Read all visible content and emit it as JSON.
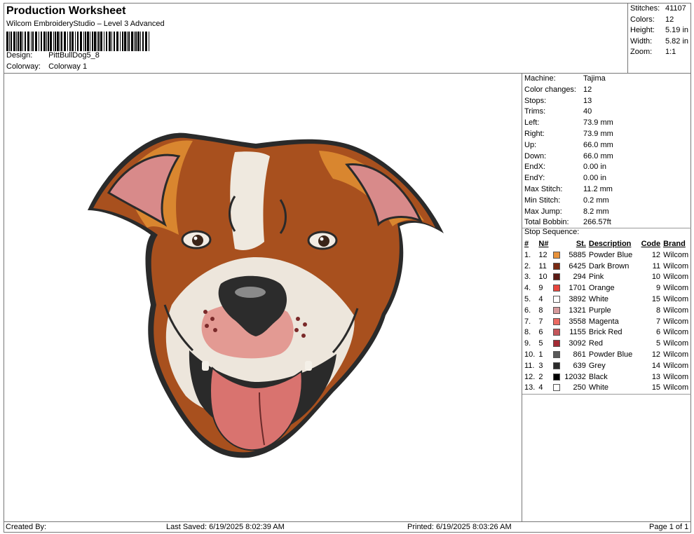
{
  "header": {
    "title": "Production Worksheet",
    "subtitle": "Wilcom EmbroideryStudio – Level 3 Advanced",
    "design_label": "Design:",
    "design_value": "PittBullDog5_8",
    "colorway_label": "Colorway:",
    "colorway_value": "Colorway 1"
  },
  "stats": [
    {
      "label": "Stitches:",
      "value": "41107"
    },
    {
      "label": "Colors:",
      "value": "12"
    },
    {
      "label": "Height:",
      "value": "5.19 in"
    },
    {
      "label": "Width:",
      "value": "5.82 in"
    },
    {
      "label": "Zoom:",
      "value": "1:1"
    }
  ],
  "machine_info": [
    {
      "label": "Machine:",
      "value": "Tajima"
    },
    {
      "label": "Color changes:",
      "value": "12"
    },
    {
      "label": "Stops:",
      "value": "13"
    },
    {
      "label": "Trims:",
      "value": "40"
    },
    {
      "label": "Left:",
      "value": "73.9 mm"
    },
    {
      "label": "Right:",
      "value": "73.9 mm"
    },
    {
      "label": "Up:",
      "value": "66.0 mm"
    },
    {
      "label": "Down:",
      "value": "66.0 mm"
    },
    {
      "label": "EndX:",
      "value": "0.00 in"
    },
    {
      "label": "EndY:",
      "value": "0.00 in"
    },
    {
      "label": "Max Stitch:",
      "value": "11.2 mm"
    },
    {
      "label": "Min Stitch:",
      "value": "0.2 mm"
    },
    {
      "label": "Max Jump:",
      "value": "8.2 mm"
    },
    {
      "label": "Total Bobbin:",
      "value": "266.57ft"
    }
  ],
  "stop_sequence": {
    "label": "Stop Sequence:",
    "headers": {
      "num": "#",
      "n": "N#",
      "st": "St.",
      "description": "Description",
      "code": "Code",
      "brand": "Brand"
    },
    "rows": [
      {
        "num": "1.",
        "n": "12",
        "color": "#e8923a",
        "st": "5885",
        "description": "Powder Blue",
        "code": "12",
        "brand": "Wilcom"
      },
      {
        "num": "2.",
        "n": "11",
        "color": "#7a2a12",
        "st": "6425",
        "description": "Dark Brown",
        "code": "11",
        "brand": "Wilcom"
      },
      {
        "num": "3.",
        "n": "10",
        "color": "#5c1a14",
        "st": "294",
        "description": "Pink",
        "code": "10",
        "brand": "Wilcom"
      },
      {
        "num": "4.",
        "n": "9",
        "color": "#e8463e",
        "st": "1701",
        "description": "Orange",
        "code": "9",
        "brand": "Wilcom"
      },
      {
        "num": "5.",
        "n": "4",
        "color": "#ffffff",
        "st": "3892",
        "description": "White",
        "code": "15",
        "brand": "Wilcom"
      },
      {
        "num": "6.",
        "n": "8",
        "color": "#d79a9c",
        "st": "1321",
        "description": "Purple",
        "code": "8",
        "brand": "Wilcom"
      },
      {
        "num": "7.",
        "n": "7",
        "color": "#ec6a62",
        "st": "3558",
        "description": "Magenta",
        "code": "7",
        "brand": "Wilcom"
      },
      {
        "num": "8.",
        "n": "6",
        "color": "#c4565a",
        "st": "1155",
        "description": "Brick Red",
        "code": "6",
        "brand": "Wilcom"
      },
      {
        "num": "9.",
        "n": "5",
        "color": "#a42a34",
        "st": "3092",
        "description": "Red",
        "code": "5",
        "brand": "Wilcom"
      },
      {
        "num": "10.",
        "n": "1",
        "color": "#5a5a5a",
        "st": "861",
        "description": "Powder Blue",
        "code": "12",
        "brand": "Wilcom"
      },
      {
        "num": "11.",
        "n": "3",
        "color": "#2a2a2a",
        "st": "639",
        "description": "Grey",
        "code": "14",
        "brand": "Wilcom"
      },
      {
        "num": "12.",
        "n": "2",
        "color": "#000000",
        "st": "12032",
        "description": "Black",
        "code": "13",
        "brand": "Wilcom"
      },
      {
        "num": "13.",
        "n": "4",
        "color": "#ffffff",
        "st": "250",
        "description": "White",
        "code": "15",
        "brand": "Wilcom"
      }
    ]
  },
  "footer": {
    "created_by": "Created By:",
    "last_saved": "Last Saved: 6/19/2025 8:02:39 AM",
    "printed": "Printed: 6/19/2025 8:03:26 AM",
    "page": "Page 1 of 1"
  }
}
